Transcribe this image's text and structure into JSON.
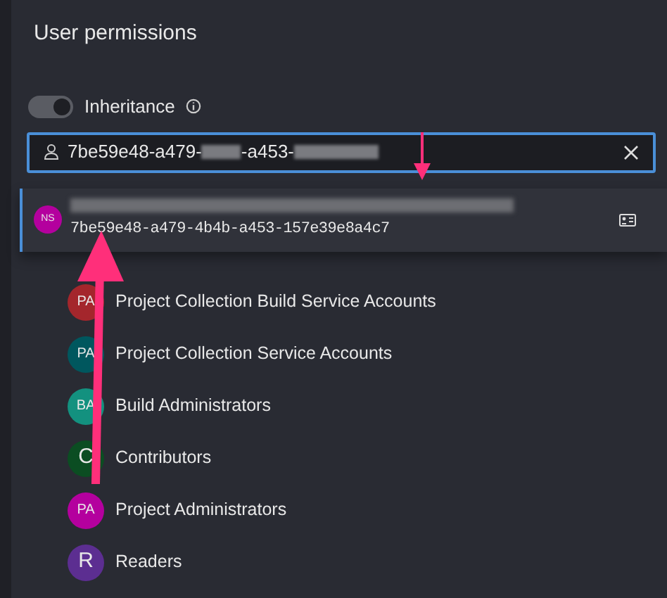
{
  "title": "User permissions",
  "inheritance": {
    "label": "Inheritance",
    "on": true
  },
  "search": {
    "segments": [
      {
        "kind": "text",
        "text": "7be59e48-a479-"
      },
      {
        "kind": "redacted"
      },
      {
        "kind": "text",
        "text": "-a453-"
      },
      {
        "kind": "redacted"
      }
    ]
  },
  "suggestion": {
    "initials": "NS",
    "color": "#b4009e",
    "id": "7be59e48-a479-4b4b-a453-157e39e8a4c7"
  },
  "members": [
    {
      "initials": "PA",
      "name": "Project Collection Build Service Accounts",
      "color": "#a4262c"
    },
    {
      "initials": "PA",
      "name": "Project Collection Service Accounts",
      "color": "#00575e"
    },
    {
      "initials": "BA",
      "name": "Build Administrators",
      "color": "#13917f"
    },
    {
      "initials": "C",
      "name": "Contributors",
      "color": "#0b4d22"
    },
    {
      "initials": "PA",
      "name": "Project Administrators",
      "color": "#b4009e"
    },
    {
      "initials": "R",
      "name": "Readers",
      "color": "#5c2e91"
    }
  ]
}
